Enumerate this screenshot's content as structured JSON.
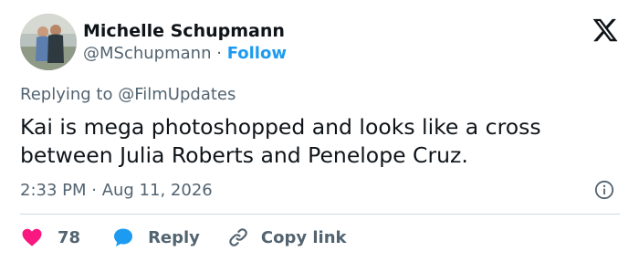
{
  "author": {
    "name": "Michelle Schupmann",
    "handle": "@MSchupmann",
    "separator": "·",
    "follow_label": "Follow"
  },
  "reply_context": {
    "prefix": "Replying to",
    "mention": "@FilmUpdates"
  },
  "tweet": {
    "text": "Kai is mega photoshopped and looks like a cross between Julia Roberts and Penelope Cruz.",
    "timestamp": "2:33 PM · Aug 11, 2026"
  },
  "actions": {
    "like_count": "78",
    "reply_label": "Reply",
    "copy_label": "Copy link"
  },
  "colors": {
    "text": "#0f1419",
    "secondary": "#536471",
    "accent": "#1d9bf0",
    "like": "#f91880",
    "divider": "#cfd9de"
  },
  "icons": [
    "x-logo-icon",
    "info-icon",
    "heart-icon",
    "reply-bubble-icon",
    "link-icon"
  ]
}
